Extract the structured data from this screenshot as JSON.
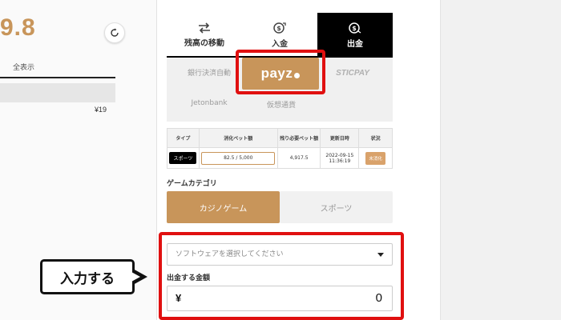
{
  "left": {
    "balance_fragment": "9.8",
    "show_all": "全表示",
    "yen_small": "¥19"
  },
  "tabs": [
    {
      "label": "残高の移動",
      "icon": "transfer-arrows-icon",
      "active": false
    },
    {
      "label": "入金",
      "icon": "deposit-coin-icon",
      "active": false
    },
    {
      "label": "出金",
      "icon": "withdraw-coin-icon",
      "active": true
    }
  ],
  "payment_methods": {
    "bank": "銀行決済自動",
    "payz": "payz",
    "sticpay": "STICPAY",
    "jetonbank": "Jetonbank",
    "crypto": "仮想通貨"
  },
  "table": {
    "headers": [
      "タイプ",
      "消化ベット額",
      "残り必要ベット額",
      "更新日時",
      "状況"
    ],
    "rows": [
      {
        "type": "スポーツ",
        "bet": "82.5 / 5,000",
        "remaining": "4,917.5",
        "updated": "2022-09-15 11:36:19",
        "status": "未消化"
      }
    ]
  },
  "game_category": {
    "label": "ゲームカテゴリ",
    "options": [
      "カジノゲーム",
      "スポーツ"
    ],
    "selected": "カジノゲーム"
  },
  "software": {
    "placeholder": "ソフトウェアを選択してください"
  },
  "amount": {
    "label": "出金する金額",
    "currency": "¥",
    "value": "0"
  },
  "annotation": {
    "callout_text": "入力する"
  },
  "colors": {
    "accent": "#c8955a",
    "highlight": "#e01010",
    "active_tab": "#000000"
  }
}
